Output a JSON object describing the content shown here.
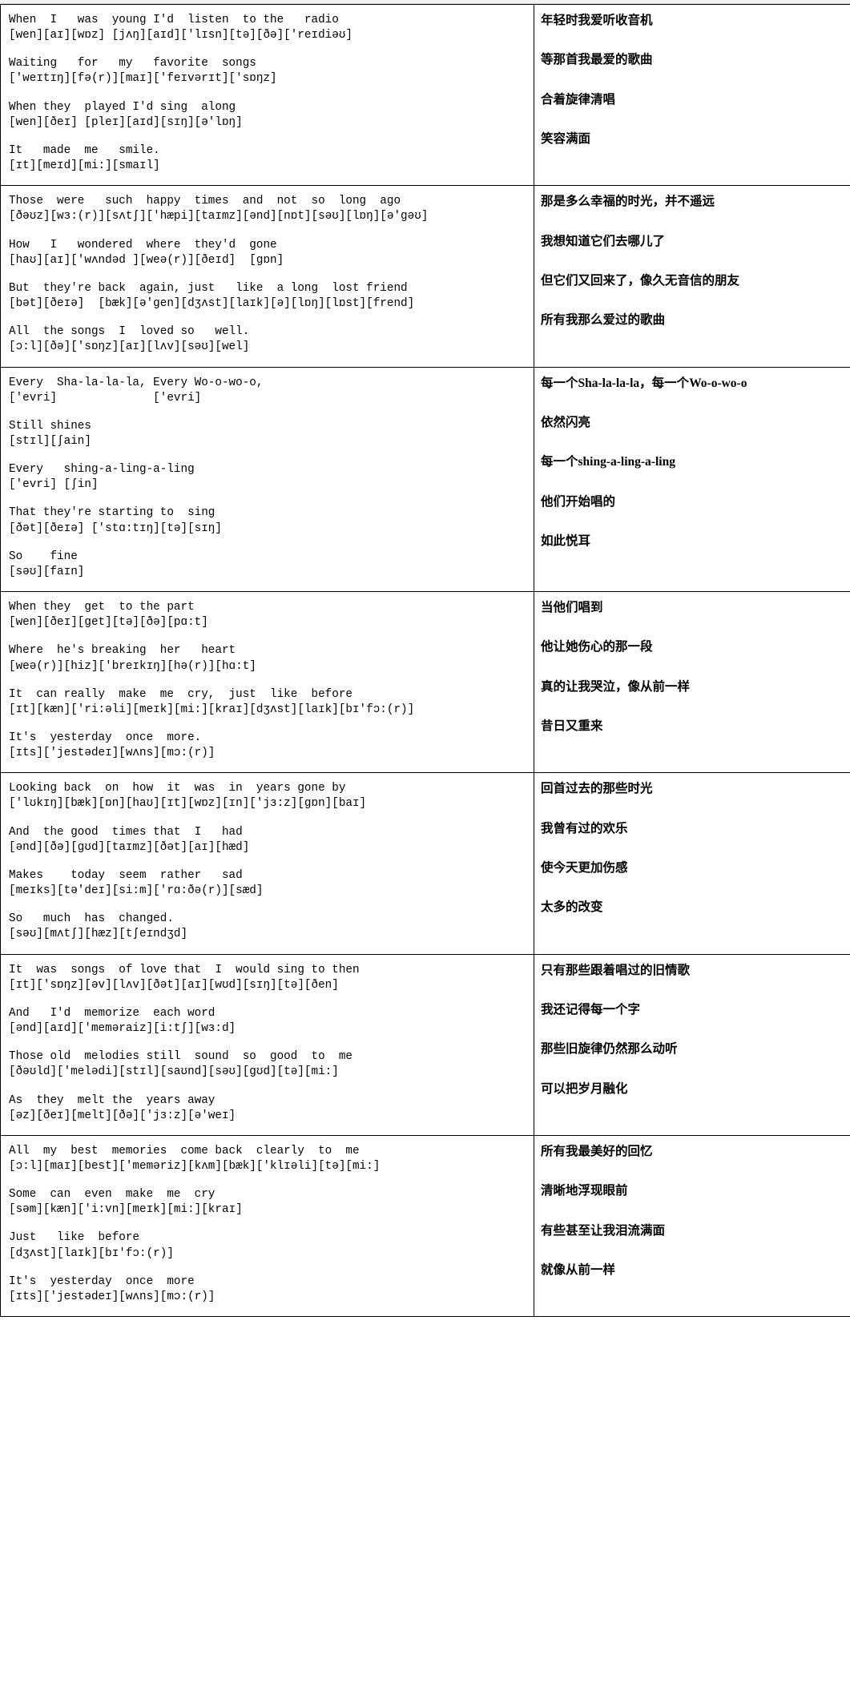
{
  "document": {
    "type": "bilingual-lyrics-table",
    "columns": [
      "english_with_ipa",
      "chinese_translation"
    ],
    "song_title_implied": "Yesterday Once More"
  },
  "blocks": [
    {
      "lines": [
        {
          "words": "When  I   was  young I'd  listen  to the   radio",
          "ipa": "[wen][aɪ][wɒz] [jʌŋ][aɪd]['lɪsn][tə][ðə]['reɪdiəʊ]"
        },
        {
          "words": "Waiting   for   my   favorite  songs",
          "ipa": "['weɪtɪŋ][fə(r)][maɪ]['feɪvərɪt]['sɒŋz]"
        },
        {
          "words": "When they  played I'd sing  along",
          "ipa": "[wen][ðeɪ] [pleɪ][aɪd][sɪŋ][ə'lɒŋ]"
        },
        {
          "words": "It   made  me   smile.",
          "ipa": "[ɪt][meɪd][mi:][smaɪl]"
        }
      ],
      "zh": [
        "年轻时我爱听收音机",
        "等那首我最爱的歌曲",
        "合着旋律清唱",
        "笑容满面"
      ]
    },
    {
      "lines": [
        {
          "words": "Those  were   such  happy  times  and  not  so  long  ago",
          "ipa": "[ðəʊz][wɜ:(r)][sʌtʃ]['hæpi][taɪmz][ənd][nɒt][səʊ][lɒŋ][ə'gəʊ]"
        },
        {
          "words": "How   I   wondered  where  they'd  gone",
          "ipa": "[haʊ][aɪ]['wʌndəd ][weə(r)][ðeɪd]  [gɒn]"
        },
        {
          "words": "But  they're back  again, just   like  a long  lost friend",
          "ipa": "[bət][ðeɪə]  [bæk][ə'gen][dʒʌst][laɪk][ə][lɒŋ][lɒst][frend]"
        },
        {
          "words": "All  the songs  I  loved so   well.",
          "ipa": "[ɔ:l][ðə]['sɒŋz][aɪ][lʌv][səʊ][wel]"
        }
      ],
      "zh": [
        "那是多么幸福的时光，并不遥远",
        "我想知道它们去哪儿了",
        "但它们又回来了，像久无音信的朋友",
        "所有我那么爱过的歌曲"
      ]
    },
    {
      "lines": [
        {
          "words": "Every  Sha-la-la-la, Every Wo-o-wo-o,",
          "ipa": "['evri]              ['evri]"
        },
        {
          "words": "Still shines",
          "ipa": "[stɪl][ʃain]"
        },
        {
          "words": "Every   shing-a-ling-a-ling",
          "ipa": "['evri] [ʃin]"
        },
        {
          "words": "That they're starting to  sing",
          "ipa": "[ðət][ðeɪə] ['stɑ:tɪŋ][tə][sɪŋ]"
        },
        {
          "words": "So    fine",
          "ipa": "[səʊ][faɪn]"
        }
      ],
      "zh": [
        "每一个Sha-la-la-la，每一个Wo-o-wo-o",
        "依然闪亮",
        "每一个shing-a-ling-a-ling",
        "他们开始唱的",
        "如此悦耳"
      ]
    },
    {
      "lines": [
        {
          "words": "When they  get  to the part",
          "ipa": "[wen][ðeɪ][get][tə][ðə][pɑ:t]"
        },
        {
          "words": "Where  he's breaking  her   heart",
          "ipa": "[weə(r)][hiz]['breɪkɪŋ][hə(r)][hɑ:t]"
        },
        {
          "words": "It  can really  make  me  cry,  just  like  before",
          "ipa": "[ɪt][kæn]['ri:əli][meɪk][mi:][kraɪ][dʒʌst][laɪk][bɪ'fɔ:(r)]"
        },
        {
          "words": "It's  yesterday  once  more.",
          "ipa": "[ɪts]['jestədeɪ][wʌns][mɔ:(r)]"
        }
      ],
      "zh": [
        "当他们唱到",
        "他让她伤心的那一段",
        "真的让我哭泣，像从前一样",
        "昔日又重来"
      ]
    },
    {
      "lines": [
        {
          "words": "Looking back  on  how  it  was  in  years gone by",
          "ipa": "['lʊkɪŋ][bæk][ɒn][haʊ][ɪt][wɒz][ɪn]['jɜ:z][gɒn][baɪ]"
        },
        {
          "words": "And  the good  times that  I   had",
          "ipa": "[ənd][ðə][gʊd][taɪmz][ðət][aɪ][hæd]"
        },
        {
          "words": "Makes    today  seem  rather   sad",
          "ipa": "[meɪks][tə'deɪ][si:m]['rɑ:ðə(r)][sæd]"
        },
        {
          "words": "So   much  has  changed.",
          "ipa": "[səʊ][mʌtʃ][hæz][tʃeɪndʒd]"
        }
      ],
      "zh": [
        "回首过去的那些时光",
        "我曾有过的欢乐",
        "使今天更加伤感",
        "太多的改变"
      ]
    },
    {
      "lines": [
        {
          "words": "It  was  songs  of love that  I  would sing to then",
          "ipa": "[ɪt]['sɒŋz][əv][lʌv][ðət][aɪ][wʊd][sɪŋ][tə][ðen]"
        },
        {
          "words": "And   I'd  memorize  each word",
          "ipa": "[ənd][aɪd]['meməraiz][i:tʃ][wɜ:d]"
        },
        {
          "words": "Those old  melodies still  sound  so  good  to  me",
          "ipa": "[ðəʊld]['melədi][stɪl][saʊnd][səʊ][gʊd][tə][mi:]"
        },
        {
          "words": "As  they  melt the  years away",
          "ipa": "[əz][ðeɪ][melt][ðə]['jɜ:z][ə'weɪ]"
        }
      ],
      "zh": [
        "只有那些跟着唱过的旧情歌",
        "我还记得每一个字",
        "那些旧旋律仍然那么动听",
        "可以把岁月融化"
      ]
    },
    {
      "lines": [
        {
          "words": "All  my  best  memories  come back  clearly  to  me",
          "ipa": "[ɔ:l][maɪ][best]['meməriz][kʌm][bæk]['klɪəli][tə][mi:]"
        },
        {
          "words": "Some  can  even  make  me  cry",
          "ipa": "[səm][kæn]['i:vn][meɪk][mi:][kraɪ]"
        },
        {
          "words": "Just   like  before",
          "ipa": "[dʒʌst][laɪk][bɪ'fɔ:(r)]"
        },
        {
          "words": "It's  yesterday  once  more",
          "ipa": "[ɪts]['jestədeɪ][wʌns][mɔ:(r)]"
        }
      ],
      "zh": [
        "所有我最美好的回忆",
        "清晰地浮现眼前",
        "有些甚至让我泪流满面",
        "就像从前一样"
      ]
    }
  ]
}
